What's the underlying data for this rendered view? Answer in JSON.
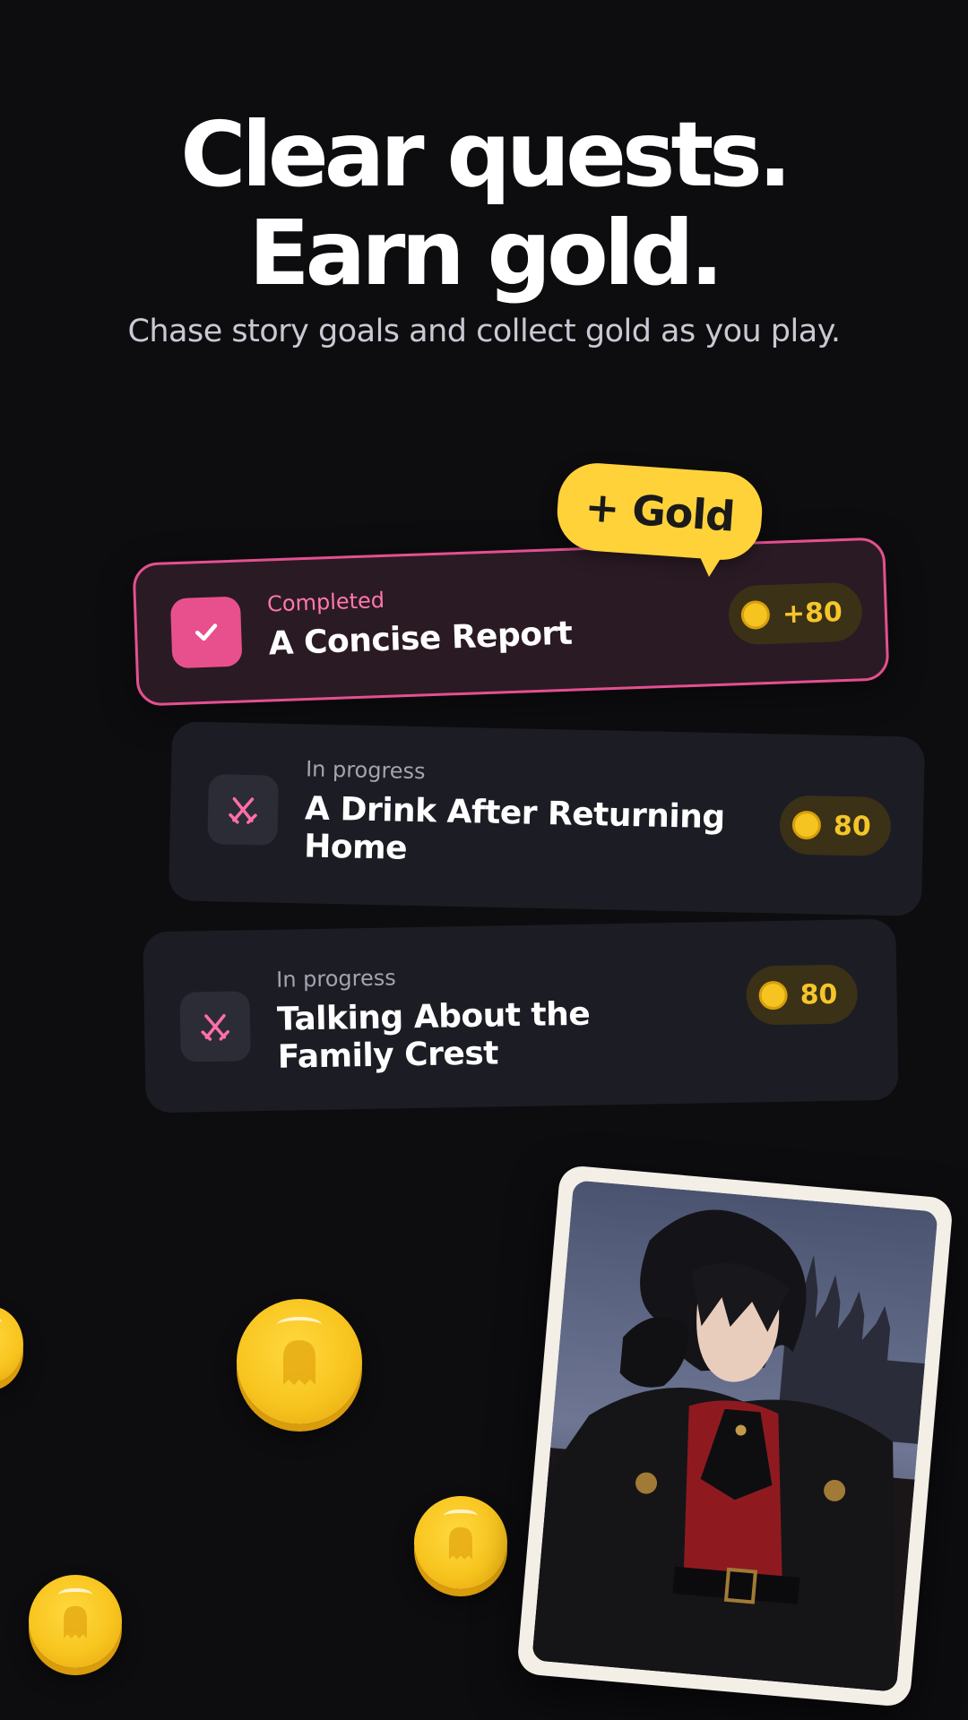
{
  "hero": {
    "title_line1": "Clear quests.",
    "title_line2": "Earn gold.",
    "subtitle": "Chase story goals and collect gold as you play."
  },
  "bubble": {
    "label": "+ Gold"
  },
  "quests": [
    {
      "status": "Completed",
      "title": "A Concise Report",
      "reward": "+80",
      "icon": "check-icon"
    },
    {
      "status": "In progress",
      "title": "A Drink After Returning Home",
      "reward": "80",
      "icon": "crossed-swords-icon"
    },
    {
      "status": "In progress",
      "title": "Talking About the Family Crest",
      "reward": "80",
      "icon": "crossed-swords-icon"
    }
  ],
  "colors": {
    "background": "#0d0d10",
    "accent_pink": "#e8508d",
    "gold": "#f5c421",
    "card_bg": "#1c1c24"
  }
}
